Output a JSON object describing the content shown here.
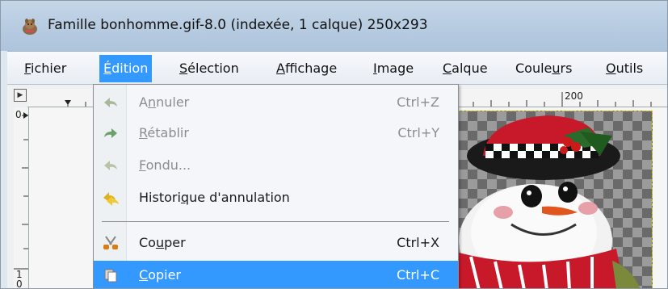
{
  "window": {
    "title": "Famille bonhomme.gif-8.0 (indexée, 1 calque) 250x293"
  },
  "menubar": {
    "items": [
      {
        "label": "Fichier"
      },
      {
        "label": "Édition"
      },
      {
        "label": "Sélection"
      },
      {
        "label": "Affichage"
      },
      {
        "label": "Image"
      },
      {
        "label": "Calque"
      },
      {
        "label": "Couleurs"
      },
      {
        "label": "Outils"
      }
    ],
    "active": "Édition"
  },
  "rulers": {
    "top_label": "200",
    "left_top_label": "0",
    "left_bottom_label_1": "1",
    "left_bottom_label_2": "0"
  },
  "edit_menu": {
    "items": [
      {
        "label": "Annuler",
        "shortcut": "Ctrl+Z",
        "enabled": false,
        "icon": "undo-icon"
      },
      {
        "label": "Rétablir",
        "shortcut": "Ctrl+Y",
        "enabled": false,
        "icon": "redo-icon"
      },
      {
        "label": "Fondu...",
        "shortcut": "",
        "enabled": false,
        "icon": "fade-icon"
      },
      {
        "label": "Historique d'annulation",
        "shortcut": "",
        "enabled": true,
        "icon": "undo-history-icon"
      },
      {
        "label": "Couper",
        "shortcut": "Ctrl+X",
        "enabled": true,
        "icon": "cut-icon"
      },
      {
        "label": "Copier",
        "shortcut": "Ctrl+C",
        "enabled": true,
        "highlighted": true,
        "icon": "copy-icon"
      }
    ]
  },
  "colors": {
    "highlight": "#3399ff",
    "disabled_text": "#8d8d8d"
  }
}
